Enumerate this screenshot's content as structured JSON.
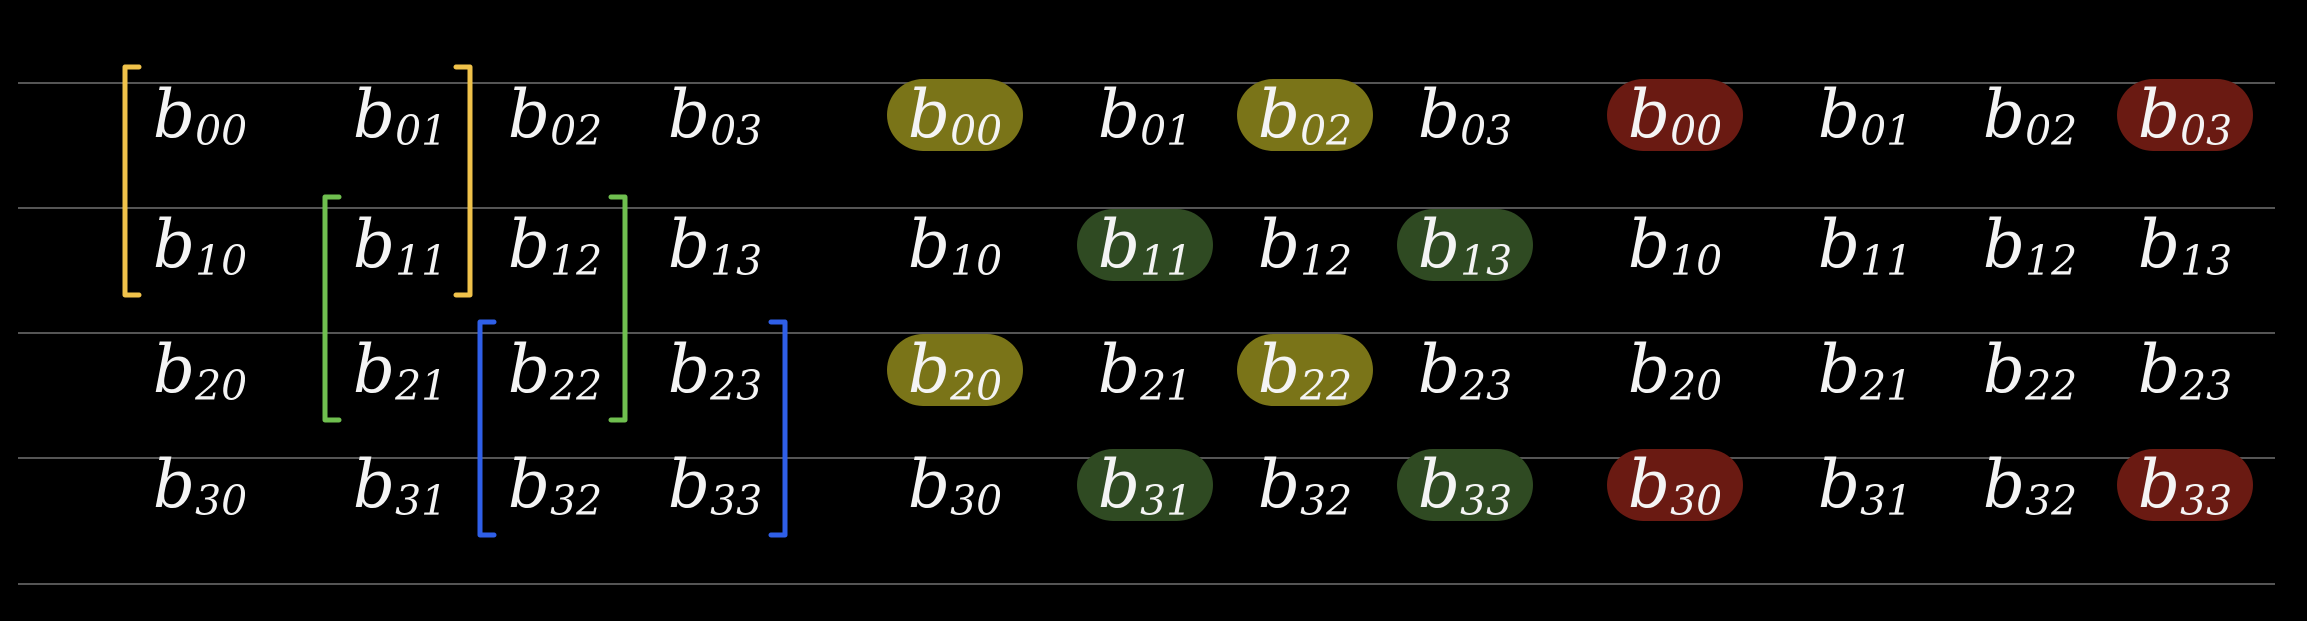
{
  "colors": {
    "background": "#000000",
    "rule_line": "#555555",
    "text": "#f4f4f4",
    "bracket_yellow": "#f0c24a",
    "bracket_green": "#6fbf4f",
    "bracket_blue": "#2f5fe8",
    "highlight_olive": "#7a7418",
    "highlight_green": "#2f4a22",
    "highlight_red": "#6a1a12"
  },
  "matrices": [
    {
      "id": "matrix-brackets",
      "rows": [
        [
          "b00",
          "b01",
          "b02",
          "b03"
        ],
        [
          "b10",
          "b11",
          "b12",
          "b13"
        ],
        [
          "b20",
          "b21",
          "b22",
          "b23"
        ],
        [
          "b30",
          "b31",
          "b32",
          "b33"
        ]
      ],
      "brackets": [
        {
          "name": "yellow-window-bracket",
          "color": "bracket_yellow",
          "rows": [
            0,
            1
          ],
          "cols": [
            0,
            1
          ]
        },
        {
          "name": "green-window-bracket",
          "color": "bracket_green",
          "rows": [
            1,
            2
          ],
          "cols": [
            1,
            2
          ]
        },
        {
          "name": "blue-window-bracket",
          "color": "bracket_blue",
          "rows": [
            2,
            3
          ],
          "cols": [
            2,
            3
          ]
        }
      ],
      "highlights": []
    },
    {
      "id": "matrix-stride-two",
      "rows": [
        [
          "b00",
          "b01",
          "b02",
          "b03"
        ],
        [
          "b10",
          "b11",
          "b12",
          "b13"
        ],
        [
          "b20",
          "b21",
          "b22",
          "b23"
        ],
        [
          "b30",
          "b31",
          "b32",
          "b33"
        ]
      ],
      "brackets": [],
      "highlights": [
        {
          "cell": [
            0,
            0
          ],
          "color": "highlight_olive"
        },
        {
          "cell": [
            0,
            2
          ],
          "color": "highlight_olive"
        },
        {
          "cell": [
            2,
            0
          ],
          "color": "highlight_olive"
        },
        {
          "cell": [
            2,
            2
          ],
          "color": "highlight_olive"
        },
        {
          "cell": [
            1,
            1
          ],
          "color": "highlight_green"
        },
        {
          "cell": [
            1,
            3
          ],
          "color": "highlight_green"
        },
        {
          "cell": [
            3,
            1
          ],
          "color": "highlight_green"
        },
        {
          "cell": [
            3,
            3
          ],
          "color": "highlight_green"
        }
      ]
    },
    {
      "id": "matrix-corners",
      "rows": [
        [
          "b00",
          "b01",
          "b02",
          "b03"
        ],
        [
          "b10",
          "b11",
          "b12",
          "b13"
        ],
        [
          "b20",
          "b21",
          "b22",
          "b23"
        ],
        [
          "b30",
          "b31",
          "b32",
          "b33"
        ]
      ],
      "brackets": [],
      "highlights": [
        {
          "cell": [
            0,
            0
          ],
          "color": "highlight_red"
        },
        {
          "cell": [
            0,
            3
          ],
          "color": "highlight_red"
        },
        {
          "cell": [
            3,
            0
          ],
          "color": "highlight_red"
        },
        {
          "cell": [
            3,
            3
          ],
          "color": "highlight_red"
        }
      ]
    }
  ]
}
